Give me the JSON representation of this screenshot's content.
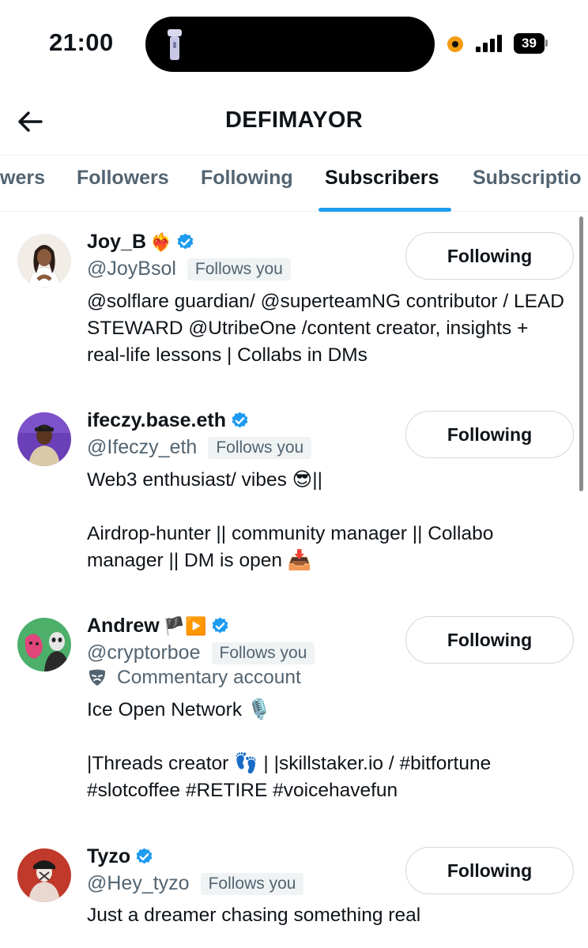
{
  "status_bar": {
    "time": "21:00",
    "battery_level": "39"
  },
  "header": {
    "title": "DEFIMAYOR"
  },
  "tabs": [
    {
      "label": "wers",
      "active": false
    },
    {
      "label": "Followers",
      "active": false
    },
    {
      "label": "Following",
      "active": false
    },
    {
      "label": "Subscribers",
      "active": true
    },
    {
      "label": "Subscriptio",
      "active": false
    }
  ],
  "users": [
    {
      "name": "Joy_B",
      "name_emoji": "❤️‍🔥",
      "verified": true,
      "handle": "@JoyBsol",
      "follows_you": "Follows you",
      "bio": "@solflare guardian/ @superteamNG contributor / LEAD STEWARD @UtribeOne /content creator, insights + real-life lessons | Collabs in DMs",
      "button": "Following"
    },
    {
      "name": "ifeczy.base.eth",
      "verified": true,
      "handle": "@Ifeczy_eth",
      "follows_you": "Follows you",
      "bio": "Web3 enthusiast/ vibes 😎||\n\nAirdrop-hunter || community manager || Collabo manager || DM is open 📥",
      "button": "Following"
    },
    {
      "name": "Andrew",
      "name_emoji": "🏴▶️",
      "verified": true,
      "handle": "@cryptorboe",
      "follows_you": "Follows you",
      "commentary": "Commentary account",
      "bio": "Ice Open Network 🎙️\n\n|Threads creator 👣 | |skillstaker.io / #bitfortune #slotcoffee #RETIRE #voicehavefun",
      "button": "Following"
    },
    {
      "name": "Tyzo",
      "verified": true,
      "handle": "@Hey_tyzo",
      "follows_you": "Follows you",
      "bio": "Just a dreamer chasing something real",
      "button": "Following"
    }
  ],
  "colors": {
    "accent": "#1d9bf0",
    "text_primary": "#0f1419",
    "text_secondary": "#536471",
    "badge_bg": "#eff3f4",
    "button_border": "#cfd9de"
  },
  "icons": [
    "flashlight-icon",
    "signal-icon",
    "battery-icon",
    "back-arrow-icon",
    "verified-badge-icon",
    "commentary-mask-icon"
  ]
}
